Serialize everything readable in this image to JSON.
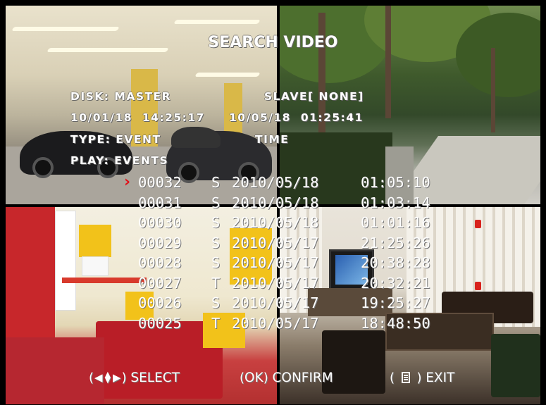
{
  "title": "SEARCH VIDEO",
  "info": {
    "disk": "DISK: MASTER",
    "slave": "SLAVE[ NONE]",
    "range_start": "10/01/18  14:25:17",
    "range_end": "10/05/18  01:25:41",
    "type": "TYPE: EVENT",
    "time": "TIME",
    "play": "PLAY: EVENTS"
  },
  "cursor_glyph": "›",
  "records": [
    {
      "num": "00032",
      "type": "S",
      "date": "2010/05/18",
      "time": "01:05:10",
      "selected": true
    },
    {
      "num": "00031",
      "type": "S",
      "date": "2010/05/18",
      "time": "01:03:14",
      "selected": false
    },
    {
      "num": "00030",
      "type": "S",
      "date": "2010/05/18",
      "time": "01:01:16",
      "selected": false
    },
    {
      "num": "00029",
      "type": "S",
      "date": "2010/05/17",
      "time": "21:25:26",
      "selected": false
    },
    {
      "num": "00028",
      "type": "S",
      "date": "2010/05/17",
      "time": "20:38:28",
      "selected": false
    },
    {
      "num": "00027",
      "type": "T",
      "date": "2010/05/17",
      "time": "20:32:21",
      "selected": false
    },
    {
      "num": "00026",
      "type": "S",
      "date": "2010/05/17",
      "time": "19:25:27",
      "selected": false
    },
    {
      "num": "00025",
      "type": "T",
      "date": "2010/05/17",
      "time": "18:48:50",
      "selected": false
    }
  ],
  "footer": {
    "select_label": "SELECT",
    "confirm_key": "OK",
    "confirm_label": "CONFIRM",
    "exit_label": "EXIT"
  },
  "icons": {
    "selection_cursor": "chevron-right-icon",
    "navigation": "arrow-keys-icon",
    "exit_key": "menu-icon"
  },
  "colors": {
    "cursor": "#e0141c",
    "text": "#ffffff"
  }
}
